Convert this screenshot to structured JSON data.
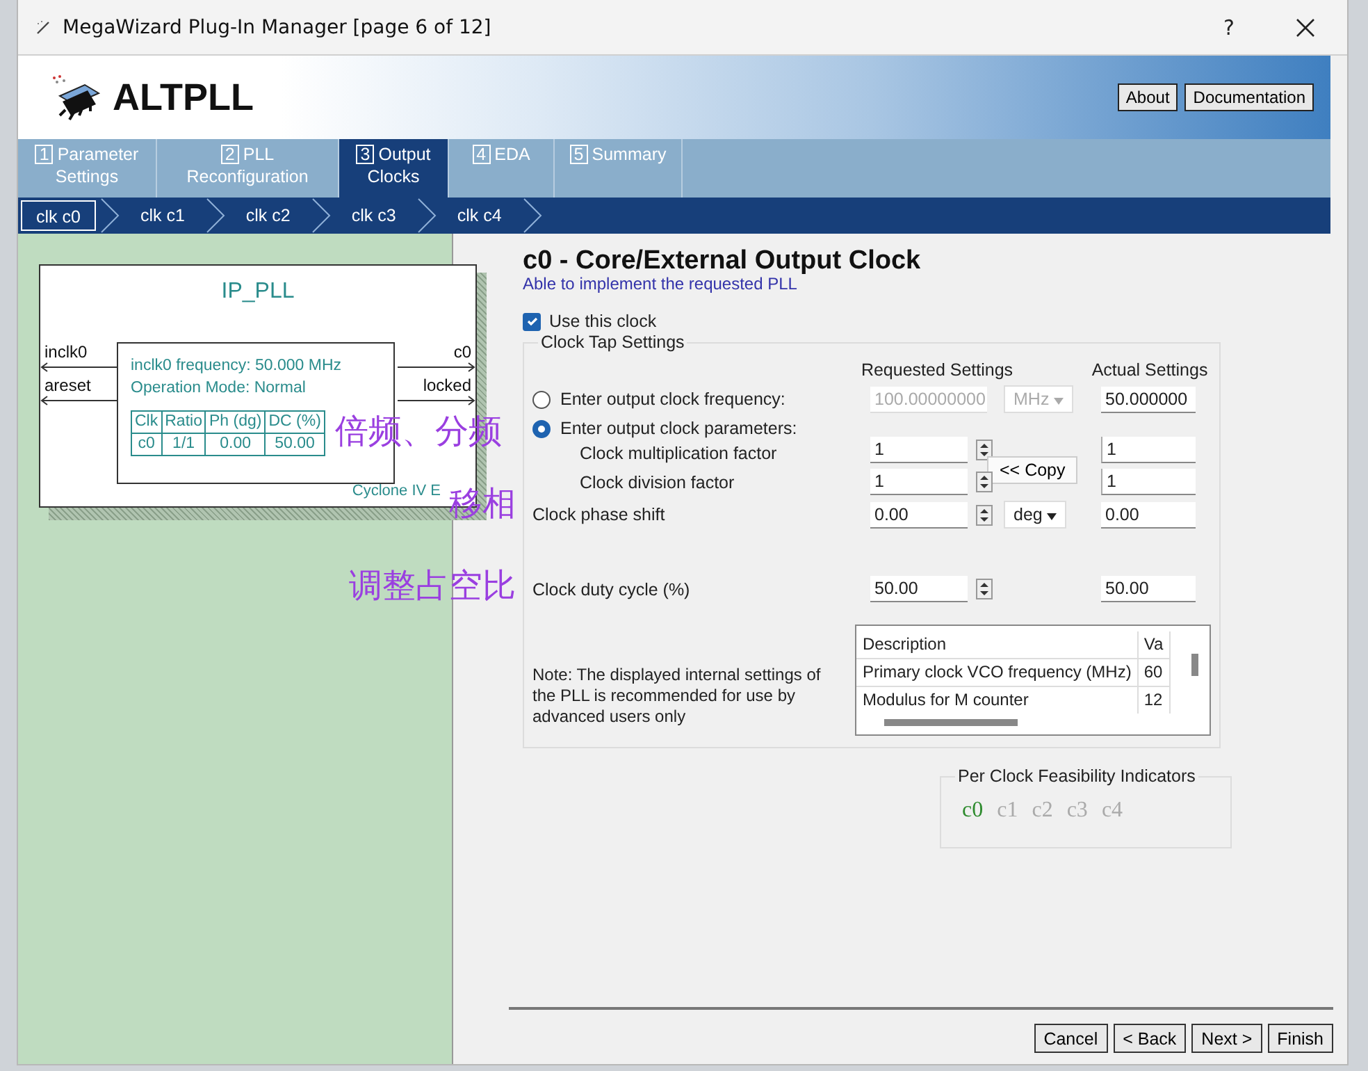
{
  "window": {
    "title": "MegaWizard Plug-In Manager [page 6 of 12]",
    "help": "?"
  },
  "header": {
    "logo": "ALTPLL",
    "buttons": [
      "About",
      "Documentation"
    ]
  },
  "steps": [
    {
      "number": "1",
      "label": "Parameter Settings",
      "selected": false
    },
    {
      "number": "2",
      "label": "PLL Reconfiguration",
      "selected": false
    },
    {
      "number": "3",
      "label": "Output Clocks",
      "selected": true
    },
    {
      "number": "4",
      "label": "EDA",
      "selected": false
    },
    {
      "number": "5",
      "label": "Summary",
      "selected": false
    }
  ],
  "clock_tabs": [
    {
      "label": "clk c0",
      "selected": true
    },
    {
      "label": "clk c1",
      "selected": false
    },
    {
      "label": "clk c2",
      "selected": false
    },
    {
      "label": "clk c3",
      "selected": false
    },
    {
      "label": "clk c4",
      "selected": false
    }
  ],
  "diagram": {
    "name": "IP_PLL",
    "inputs": [
      "inclk0",
      "areset"
    ],
    "outputs": [
      "c0",
      "locked"
    ],
    "info": [
      "inclk0 frequency: 50.000 MHz",
      "Operation Mode: Normal"
    ],
    "table": {
      "columns": [
        "Clk",
        "Ratio",
        "Ph (dg)",
        "DC (%)"
      ],
      "rows": [
        [
          "c0",
          "1/1",
          "0.00",
          "50.00"
        ]
      ]
    },
    "device": "Cyclone IV E"
  },
  "annotations": [
    "倍频、分频",
    "移相",
    "调整占空比"
  ],
  "panel": {
    "title": "c0 - Core/External Output Clock",
    "status": "Able to implement the requested PLL",
    "use_clock": {
      "label": "Use this clock",
      "checked": true
    },
    "group_title": "Clock Tap Settings",
    "requested_header": "Requested Settings",
    "actual_header": "Actual Settings",
    "mode_options": [
      {
        "label": "Enter output clock frequency:",
        "selected": false
      },
      {
        "label": "Enter output clock parameters:",
        "selected": true
      }
    ],
    "frequency": {
      "value": "100.00000000",
      "unit": "MHz",
      "disabled": true,
      "actual": "50.000000"
    },
    "multiplication": {
      "label": "Clock multiplication factor",
      "value": "1",
      "actual": "1"
    },
    "division": {
      "label": "Clock division factor",
      "value": "1",
      "actual": "1"
    },
    "copy_button": "<< Copy",
    "phase": {
      "label": "Clock phase shift",
      "value": "0.00",
      "unit": "deg",
      "actual": "0.00"
    },
    "duty": {
      "label": "Clock duty cycle (%)",
      "value": "50.00",
      "actual": "50.00"
    },
    "note": "Note: The displayed internal settings of the PLL is recommended for use by advanced users only",
    "settings_table": {
      "columns": [
        "Description",
        "Va"
      ],
      "rows": [
        [
          "Primary clock VCO frequency (MHz)",
          "60"
        ],
        [
          "Modulus for M counter",
          "12"
        ]
      ]
    },
    "feasibility": {
      "title": "Per Clock Feasibility Indicators",
      "clocks": [
        {
          "label": "c0",
          "feasible": true
        },
        {
          "label": "c1",
          "feasible": false
        },
        {
          "label": "c2",
          "feasible": false
        },
        {
          "label": "c3",
          "feasible": false
        },
        {
          "label": "c4",
          "feasible": false
        }
      ]
    }
  },
  "footer_buttons": [
    "Cancel",
    "< Back",
    "Next >",
    "Finish"
  ]
}
